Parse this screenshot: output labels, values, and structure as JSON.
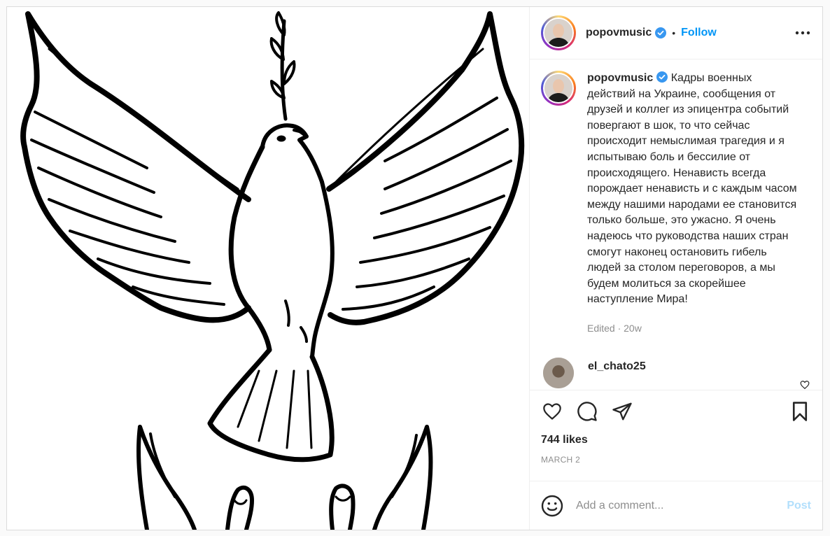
{
  "header": {
    "username": "popovmusic",
    "follow_label": "Follow",
    "dot": "•",
    "icons": [
      "verified-badge-icon",
      "more-options-icon"
    ]
  },
  "caption": {
    "username": "popovmusic",
    "text": "Кадры военных действий на Украине, сообщения от друзей и коллег из эпицентра событий повергают в шок, то что сейчас происходит немыслимая трагедия и я испытываю боль и бессилие от происходящего. Ненависть всегда порождает ненависть и с каждым часом между нашими народами ее становится только больше, это ужасно. Я очень надеюсь что руководства наших стран смогут наконец остановить гибель людей за столом переговоров, а мы будем молиться за скорейшее наступление Мира!",
    "meta": "Edited · 20w"
  },
  "comments": [
    {
      "username": "el_chato25"
    }
  ],
  "actions": {
    "icons": [
      "like-icon",
      "comment-icon",
      "share-icon",
      "bookmark-icon"
    ],
    "likes": "744 likes",
    "date": "MARCH 2"
  },
  "add_comment": {
    "placeholder": "Add a comment...",
    "post_label": "Post"
  },
  "colors": {
    "accent": "#0095f6",
    "post_disabled": "#b2dffc",
    "muted": "#8e8e8e"
  }
}
